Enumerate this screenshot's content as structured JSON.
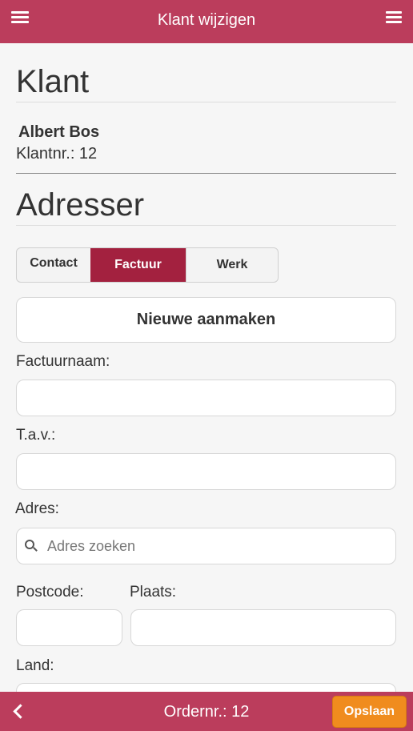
{
  "header": {
    "title": "Klant wijzigen",
    "left_menu_icon": "hamburger-icon",
    "right_menu_icon": "hamburger-icon"
  },
  "customer": {
    "section_title": "Klant",
    "name": "Albert Bos",
    "number_label": "Klantnr.: 12"
  },
  "addresses": {
    "section_title": "Adresser",
    "tabs": [
      {
        "label": "Contact",
        "active": false
      },
      {
        "label": "Factuur",
        "active": true
      },
      {
        "label": "Werk",
        "active": false
      }
    ],
    "new_button": "Nieuwe aanmaken"
  },
  "form": {
    "factuurnaam_label": "Factuurnaam:",
    "factuurnaam_value": "",
    "tav_label": "T.a.v.:",
    "tav_value": "",
    "adres_label": "Adres:",
    "adres_placeholder": "Adres zoeken",
    "postcode_label": "Postcode:",
    "postcode_value": "",
    "plaats_label": "Plaats:",
    "plaats_value": "",
    "land_label": "Land:"
  },
  "footer": {
    "ordernr": "Ordernr.: 12",
    "save_label": "Opslaan",
    "back_icon": "chevron-left-icon"
  },
  "colors": {
    "brand": "#bb3d5c",
    "active_tab": "#a3213f",
    "save": "#f08c1e"
  }
}
